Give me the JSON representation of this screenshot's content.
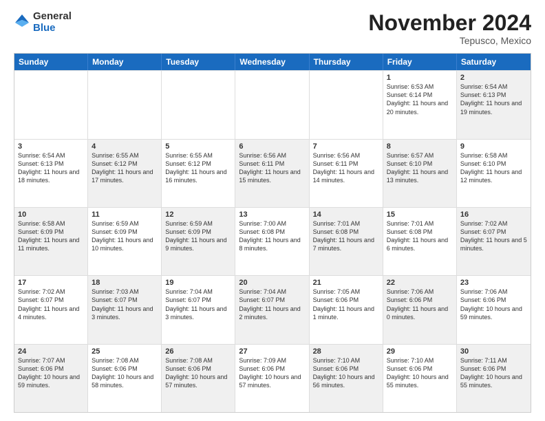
{
  "logo": {
    "general": "General",
    "blue": "Blue"
  },
  "header": {
    "month": "November 2024",
    "location": "Tepusco, Mexico"
  },
  "days_of_week": [
    "Sunday",
    "Monday",
    "Tuesday",
    "Wednesday",
    "Thursday",
    "Friday",
    "Saturday"
  ],
  "weeks": [
    [
      {
        "day": "",
        "info": "",
        "shaded": false,
        "empty": true
      },
      {
        "day": "",
        "info": "",
        "shaded": false,
        "empty": true
      },
      {
        "day": "",
        "info": "",
        "shaded": false,
        "empty": true
      },
      {
        "day": "",
        "info": "",
        "shaded": false,
        "empty": true
      },
      {
        "day": "",
        "info": "",
        "shaded": false,
        "empty": true
      },
      {
        "day": "1",
        "info": "Sunrise: 6:53 AM\nSunset: 6:14 PM\nDaylight: 11 hours and 20 minutes.",
        "shaded": false
      },
      {
        "day": "2",
        "info": "Sunrise: 6:54 AM\nSunset: 6:13 PM\nDaylight: 11 hours and 19 minutes.",
        "shaded": true
      }
    ],
    [
      {
        "day": "3",
        "info": "Sunrise: 6:54 AM\nSunset: 6:13 PM\nDaylight: 11 hours and 18 minutes.",
        "shaded": false
      },
      {
        "day": "4",
        "info": "Sunrise: 6:55 AM\nSunset: 6:12 PM\nDaylight: 11 hours and 17 minutes.",
        "shaded": true
      },
      {
        "day": "5",
        "info": "Sunrise: 6:55 AM\nSunset: 6:12 PM\nDaylight: 11 hours and 16 minutes.",
        "shaded": false
      },
      {
        "day": "6",
        "info": "Sunrise: 6:56 AM\nSunset: 6:11 PM\nDaylight: 11 hours and 15 minutes.",
        "shaded": true
      },
      {
        "day": "7",
        "info": "Sunrise: 6:56 AM\nSunset: 6:11 PM\nDaylight: 11 hours and 14 minutes.",
        "shaded": false
      },
      {
        "day": "8",
        "info": "Sunrise: 6:57 AM\nSunset: 6:10 PM\nDaylight: 11 hours and 13 minutes.",
        "shaded": true
      },
      {
        "day": "9",
        "info": "Sunrise: 6:58 AM\nSunset: 6:10 PM\nDaylight: 11 hours and 12 minutes.",
        "shaded": false
      }
    ],
    [
      {
        "day": "10",
        "info": "Sunrise: 6:58 AM\nSunset: 6:09 PM\nDaylight: 11 hours and 11 minutes.",
        "shaded": true
      },
      {
        "day": "11",
        "info": "Sunrise: 6:59 AM\nSunset: 6:09 PM\nDaylight: 11 hours and 10 minutes.",
        "shaded": false
      },
      {
        "day": "12",
        "info": "Sunrise: 6:59 AM\nSunset: 6:09 PM\nDaylight: 11 hours and 9 minutes.",
        "shaded": true
      },
      {
        "day": "13",
        "info": "Sunrise: 7:00 AM\nSunset: 6:08 PM\nDaylight: 11 hours and 8 minutes.",
        "shaded": false
      },
      {
        "day": "14",
        "info": "Sunrise: 7:01 AM\nSunset: 6:08 PM\nDaylight: 11 hours and 7 minutes.",
        "shaded": true
      },
      {
        "day": "15",
        "info": "Sunrise: 7:01 AM\nSunset: 6:08 PM\nDaylight: 11 hours and 6 minutes.",
        "shaded": false
      },
      {
        "day": "16",
        "info": "Sunrise: 7:02 AM\nSunset: 6:07 PM\nDaylight: 11 hours and 5 minutes.",
        "shaded": true
      }
    ],
    [
      {
        "day": "17",
        "info": "Sunrise: 7:02 AM\nSunset: 6:07 PM\nDaylight: 11 hours and 4 minutes.",
        "shaded": false
      },
      {
        "day": "18",
        "info": "Sunrise: 7:03 AM\nSunset: 6:07 PM\nDaylight: 11 hours and 3 minutes.",
        "shaded": true
      },
      {
        "day": "19",
        "info": "Sunrise: 7:04 AM\nSunset: 6:07 PM\nDaylight: 11 hours and 3 minutes.",
        "shaded": false
      },
      {
        "day": "20",
        "info": "Sunrise: 7:04 AM\nSunset: 6:07 PM\nDaylight: 11 hours and 2 minutes.",
        "shaded": true
      },
      {
        "day": "21",
        "info": "Sunrise: 7:05 AM\nSunset: 6:06 PM\nDaylight: 11 hours and 1 minute.",
        "shaded": false
      },
      {
        "day": "22",
        "info": "Sunrise: 7:06 AM\nSunset: 6:06 PM\nDaylight: 11 hours and 0 minutes.",
        "shaded": true
      },
      {
        "day": "23",
        "info": "Sunrise: 7:06 AM\nSunset: 6:06 PM\nDaylight: 10 hours and 59 minutes.",
        "shaded": false
      }
    ],
    [
      {
        "day": "24",
        "info": "Sunrise: 7:07 AM\nSunset: 6:06 PM\nDaylight: 10 hours and 59 minutes.",
        "shaded": true
      },
      {
        "day": "25",
        "info": "Sunrise: 7:08 AM\nSunset: 6:06 PM\nDaylight: 10 hours and 58 minutes.",
        "shaded": false
      },
      {
        "day": "26",
        "info": "Sunrise: 7:08 AM\nSunset: 6:06 PM\nDaylight: 10 hours and 57 minutes.",
        "shaded": true
      },
      {
        "day": "27",
        "info": "Sunrise: 7:09 AM\nSunset: 6:06 PM\nDaylight: 10 hours and 57 minutes.",
        "shaded": false
      },
      {
        "day": "28",
        "info": "Sunrise: 7:10 AM\nSunset: 6:06 PM\nDaylight: 10 hours and 56 minutes.",
        "shaded": true
      },
      {
        "day": "29",
        "info": "Sunrise: 7:10 AM\nSunset: 6:06 PM\nDaylight: 10 hours and 55 minutes.",
        "shaded": false
      },
      {
        "day": "30",
        "info": "Sunrise: 7:11 AM\nSunset: 6:06 PM\nDaylight: 10 hours and 55 minutes.",
        "shaded": true
      }
    ]
  ]
}
